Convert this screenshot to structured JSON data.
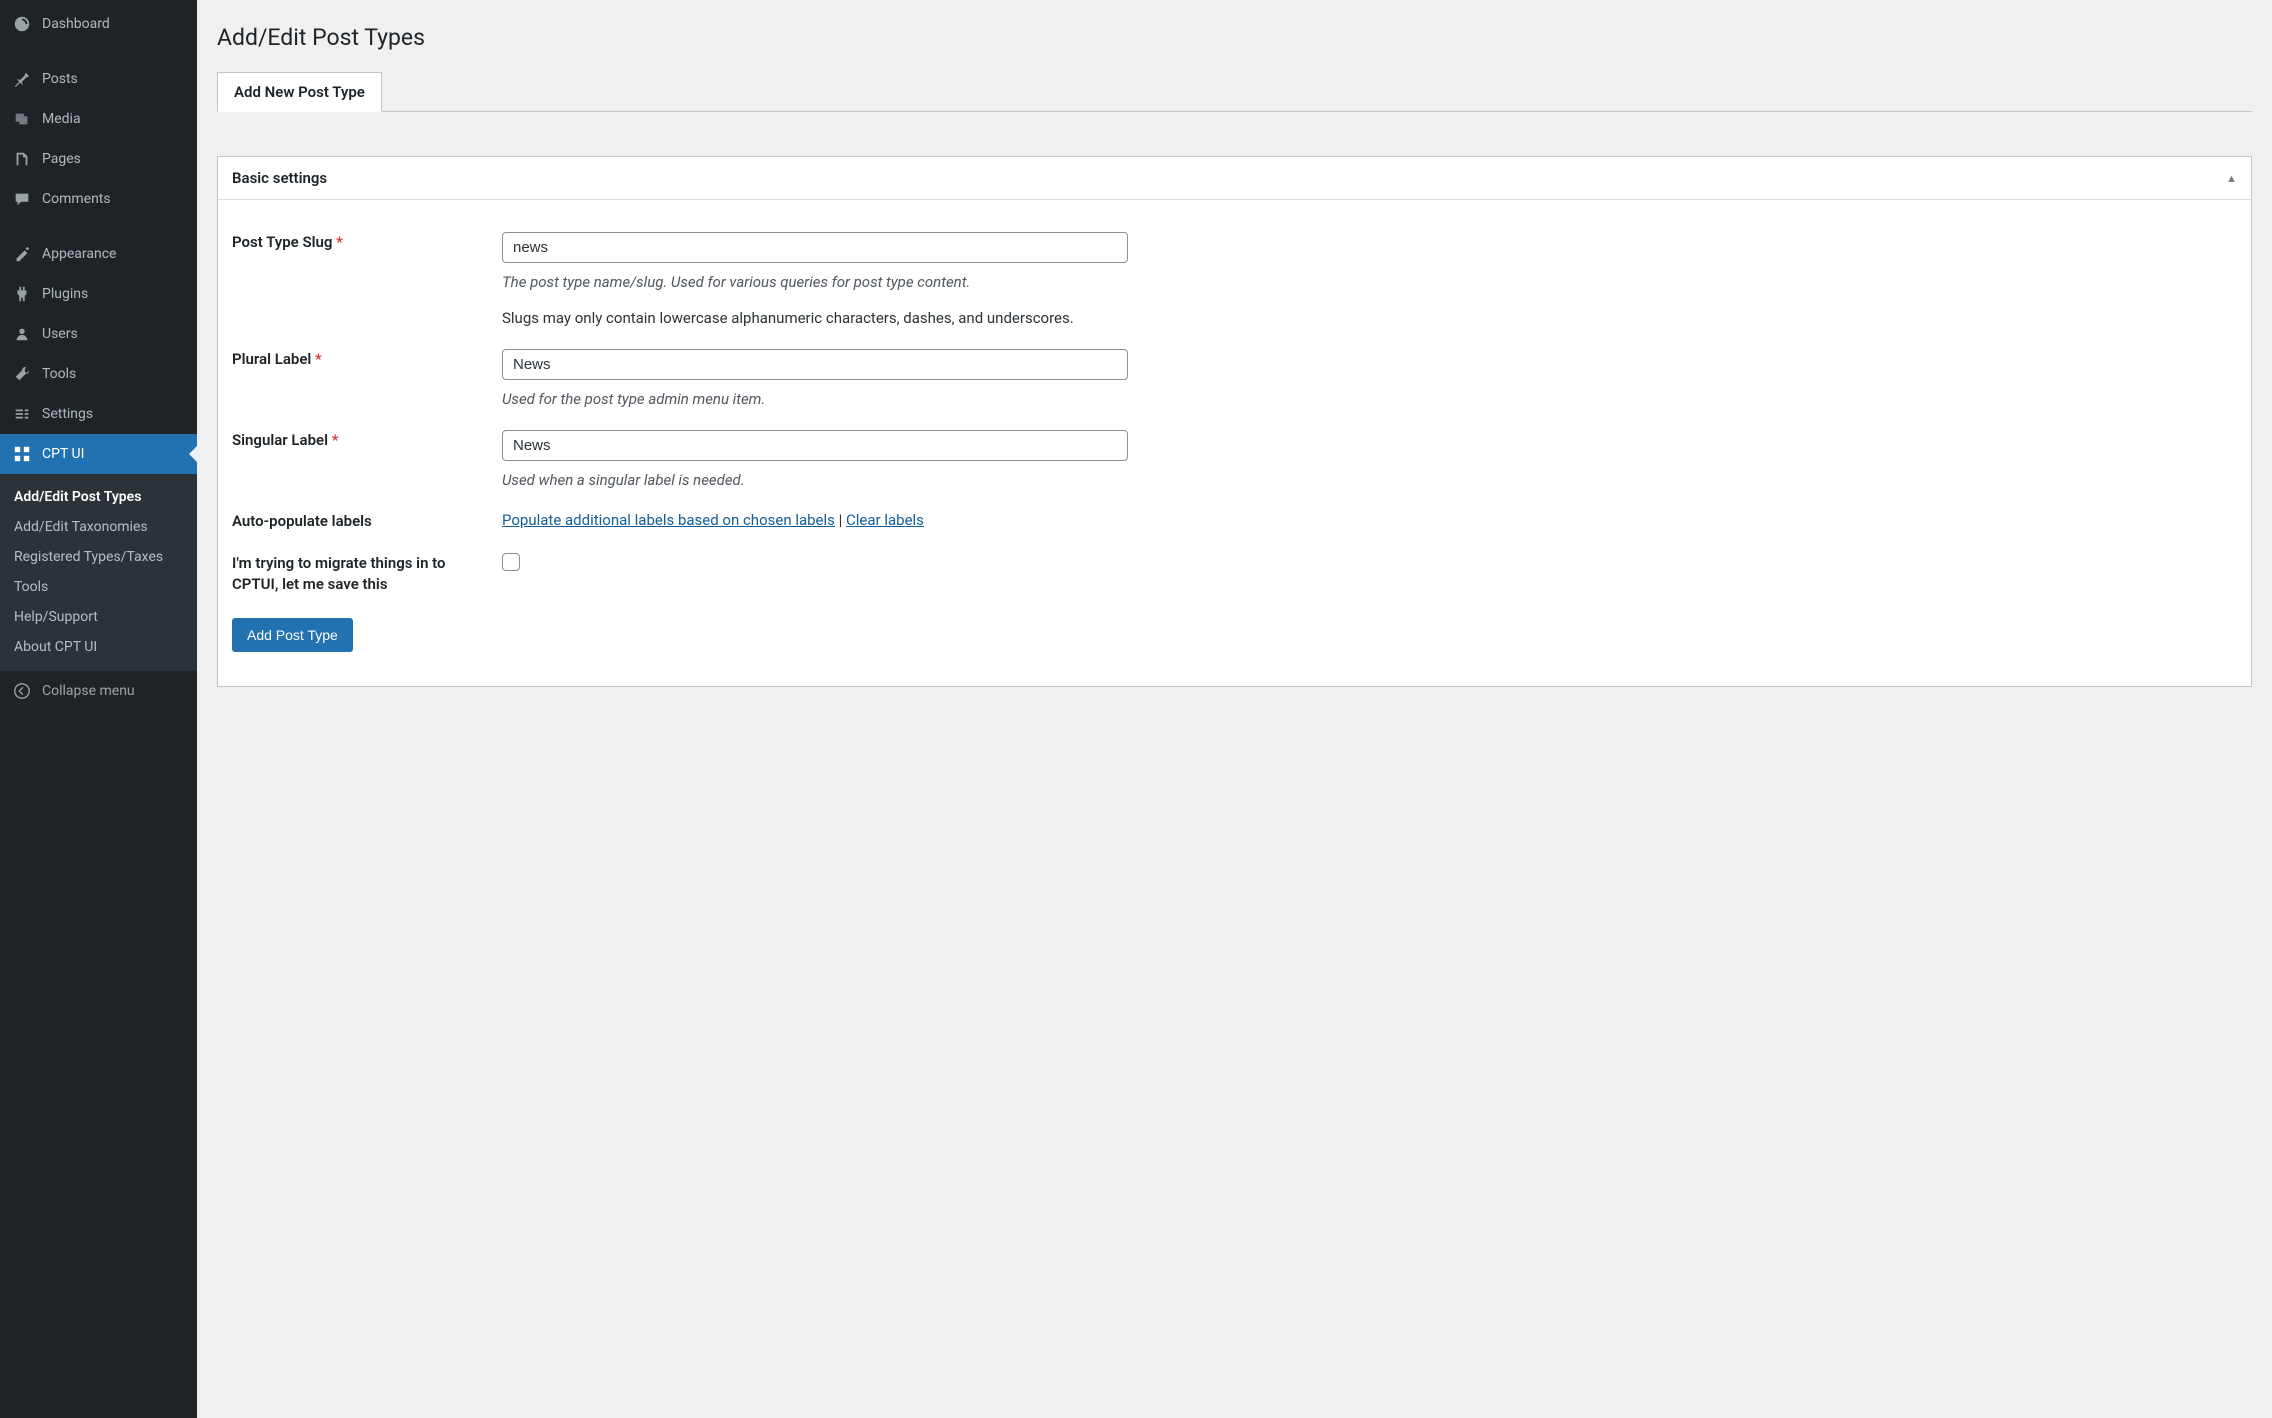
{
  "sidebar": {
    "items": [
      {
        "label": "Dashboard",
        "icon": "dashboard"
      },
      {
        "label": "Posts",
        "icon": "pin"
      },
      {
        "label": "Media",
        "icon": "media"
      },
      {
        "label": "Pages",
        "icon": "pages"
      },
      {
        "label": "Comments",
        "icon": "comments"
      },
      {
        "label": "Appearance",
        "icon": "appearance"
      },
      {
        "label": "Plugins",
        "icon": "plugins"
      },
      {
        "label": "Users",
        "icon": "users"
      },
      {
        "label": "Tools",
        "icon": "tools"
      },
      {
        "label": "Settings",
        "icon": "settings"
      },
      {
        "label": "CPT UI",
        "icon": "cptui"
      }
    ],
    "submenu": [
      "Add/Edit Post Types",
      "Add/Edit Taxonomies",
      "Registered Types/Taxes",
      "Tools",
      "Help/Support",
      "About CPT UI"
    ],
    "collapse_label": "Collapse menu"
  },
  "page": {
    "title": "Add/Edit Post Types",
    "tab_label": "Add New Post Type",
    "panel_title": "Basic settings",
    "fields": {
      "slug": {
        "label": "Post Type Slug",
        "value": "news",
        "hint": "The post type name/slug. Used for various queries for post type content.",
        "note": "Slugs may only contain lowercase alphanumeric characters, dashes, and underscores."
      },
      "plural": {
        "label": "Plural Label",
        "value": "News",
        "hint": "Used for the post type admin menu item."
      },
      "singular": {
        "label": "Singular Label",
        "value": "News",
        "hint": "Used when a singular label is needed."
      },
      "autopop": {
        "label": "Auto-populate labels",
        "link1": "Populate additional labels based on chosen labels",
        "sep": " | ",
        "link2": "Clear labels"
      },
      "migrate": {
        "label": "I'm trying to migrate things in to CPTUI, let me save this"
      }
    },
    "submit_label": "Add Post Type"
  }
}
